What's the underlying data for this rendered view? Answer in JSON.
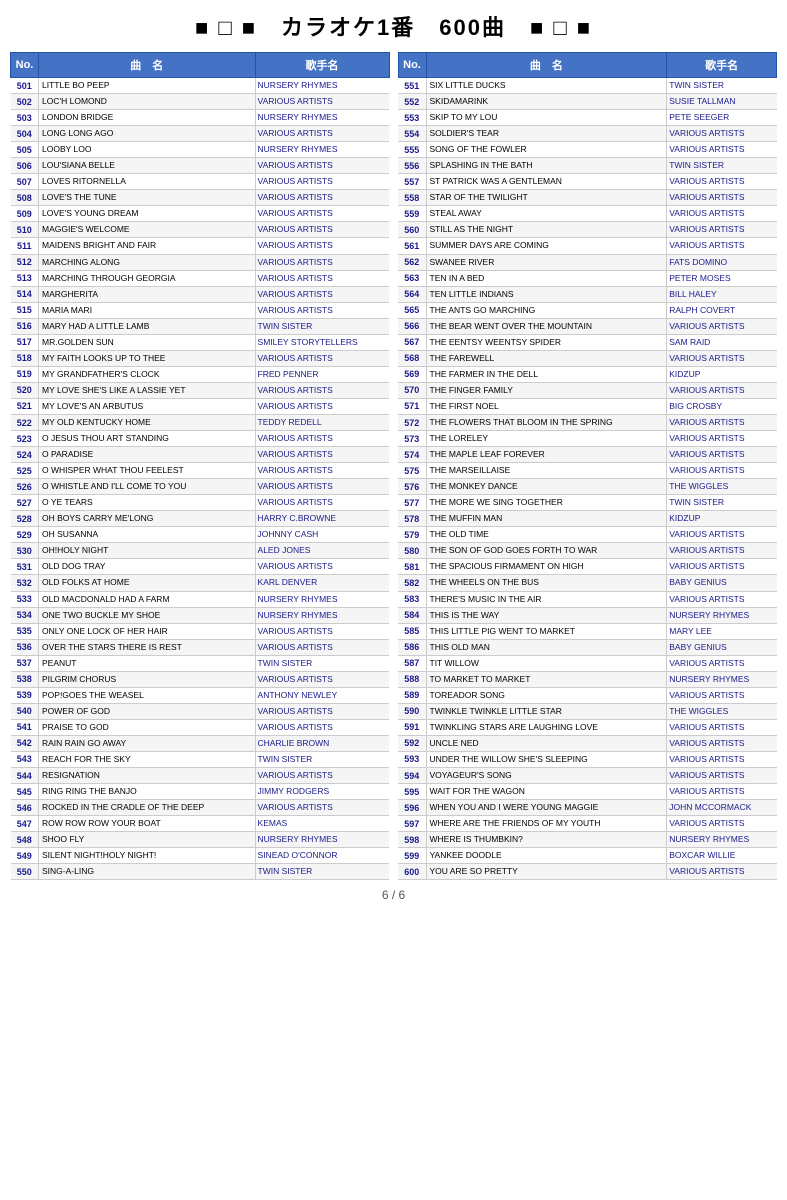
{
  "header": {
    "title": "■ □ ■　カラオケ1番　600曲　■ □ ■"
  },
  "footer": {
    "page": "6 / 6"
  },
  "left_table": {
    "headers": [
      "No.",
      "曲　名",
      "歌手名"
    ],
    "rows": [
      [
        "501",
        "LITTLE BO PEEP",
        "NURSERY RHYMES"
      ],
      [
        "502",
        "LOC'H LOMOND",
        "VARIOUS ARTISTS"
      ],
      [
        "503",
        "LONDON BRIDGE",
        "NURSERY RHYMES"
      ],
      [
        "504",
        "LONG LONG AGO",
        "VARIOUS ARTISTS"
      ],
      [
        "505",
        "LOOBY LOO",
        "NURSERY RHYMES"
      ],
      [
        "506",
        "LOU'SIANA BELLE",
        "VARIOUS ARTISTS"
      ],
      [
        "507",
        "LOVES RITORNELLA",
        "VARIOUS ARTISTS"
      ],
      [
        "508",
        "LOVE'S THE TUNE",
        "VARIOUS ARTISTS"
      ],
      [
        "509",
        "LOVE'S YOUNG DREAM",
        "VARIOUS ARTISTS"
      ],
      [
        "510",
        "MAGGIE'S WELCOME",
        "VARIOUS ARTISTS"
      ],
      [
        "511",
        "MAIDENS BRIGHT AND FAIR",
        "VARIOUS ARTISTS"
      ],
      [
        "512",
        "MARCHING ALONG",
        "VARIOUS ARTISTS"
      ],
      [
        "513",
        "MARCHING THROUGH GEORGIA",
        "VARIOUS ARTISTS"
      ],
      [
        "514",
        "MARGHERITA",
        "VARIOUS ARTISTS"
      ],
      [
        "515",
        "MARIA MARI",
        "VARIOUS ARTISTS"
      ],
      [
        "516",
        "MARY HAD A LITTLE LAMB",
        "TWIN SISTER"
      ],
      [
        "517",
        "MR.GOLDEN SUN",
        "SMILEY STORYTELLERS"
      ],
      [
        "518",
        "MY FAITH LOOKS UP TO THEE",
        "VARIOUS ARTISTS"
      ],
      [
        "519",
        "MY GRANDFATHER'S CLOCK",
        "FRED PENNER"
      ],
      [
        "520",
        "MY LOVE SHE'S LIKE A LASSIE YET",
        "VARIOUS ARTISTS"
      ],
      [
        "521",
        "MY LOVE'S AN ARBUTUS",
        "VARIOUS ARTISTS"
      ],
      [
        "522",
        "MY OLD KENTUCKY HOME",
        "TEDDY REDELL"
      ],
      [
        "523",
        "O JESUS THOU ART STANDING",
        "VARIOUS ARTISTS"
      ],
      [
        "524",
        "O PARADISE",
        "VARIOUS ARTISTS"
      ],
      [
        "525",
        "O WHISPER WHAT THOU FEELEST",
        "VARIOUS ARTISTS"
      ],
      [
        "526",
        "O WHISTLE AND I'LL COME TO YOU",
        "VARIOUS ARTISTS"
      ],
      [
        "527",
        "O YE TEARS",
        "VARIOUS ARTISTS"
      ],
      [
        "528",
        "OH BOYS CARRY ME'LONG",
        "HARRY C.BROWNE"
      ],
      [
        "529",
        "OH SUSANNA",
        "JOHNNY CASH"
      ],
      [
        "530",
        "OH!HOLY NIGHT",
        "ALED JONES"
      ],
      [
        "531",
        "OLD DOG TRAY",
        "VARIOUS ARTISTS"
      ],
      [
        "532",
        "OLD FOLKS AT HOME",
        "KARL DENVER"
      ],
      [
        "533",
        "OLD MACDONALD HAD A FARM",
        "NURSERY RHYMES"
      ],
      [
        "534",
        "ONE TWO BUCKLE MY SHOE",
        "NURSERY RHYMES"
      ],
      [
        "535",
        "ONLY ONE LOCK OF HER HAIR",
        "VARIOUS ARTISTS"
      ],
      [
        "536",
        "OVER THE STARS THERE IS REST",
        "VARIOUS ARTISTS"
      ],
      [
        "537",
        "PEANUT",
        "TWIN SISTER"
      ],
      [
        "538",
        "PILGRIM CHORUS",
        "VARIOUS ARTISTS"
      ],
      [
        "539",
        "POP!GOES THE WEASEL",
        "ANTHONY NEWLEY"
      ],
      [
        "540",
        "POWER OF GOD",
        "VARIOUS ARTISTS"
      ],
      [
        "541",
        "PRAISE TO GOD",
        "VARIOUS ARTISTS"
      ],
      [
        "542",
        "RAIN RAIN GO AWAY",
        "CHARLIE BROWN"
      ],
      [
        "543",
        "REACH FOR THE SKY",
        "TWIN SISTER"
      ],
      [
        "544",
        "RESIGNATION",
        "VARIOUS ARTISTS"
      ],
      [
        "545",
        "RING RING THE BANJO",
        "JIMMY RODGERS"
      ],
      [
        "546",
        "ROCKED IN THE CRADLE OF THE DEEP",
        "VARIOUS ARTISTS"
      ],
      [
        "547",
        "ROW ROW ROW YOUR BOAT",
        "KEMAS"
      ],
      [
        "548",
        "SHOO FLY",
        "NURSERY RHYMES"
      ],
      [
        "549",
        "SILENT NIGHT!HOLY NIGHT!",
        "SINEAD O'CONNOR"
      ],
      [
        "550",
        "SING-A-LING",
        "TWIN SISTER"
      ]
    ]
  },
  "right_table": {
    "headers": [
      "No.",
      "曲　名",
      "歌手名"
    ],
    "rows": [
      [
        "551",
        "SIX LITTLE DUCKS",
        "TWIN SISTER"
      ],
      [
        "552",
        "SKIDAMARINK",
        "SUSIE TALLMAN"
      ],
      [
        "553",
        "SKIP TO MY LOU",
        "PETE SEEGER"
      ],
      [
        "554",
        "SOLDIER'S TEAR",
        "VARIOUS ARTISTS"
      ],
      [
        "555",
        "SONG OF THE FOWLER",
        "VARIOUS ARTISTS"
      ],
      [
        "556",
        "SPLASHING IN THE BATH",
        "TWIN SISTER"
      ],
      [
        "557",
        "ST PATRICK WAS A GENTLEMAN",
        "VARIOUS ARTISTS"
      ],
      [
        "558",
        "STAR OF THE TWILIGHT",
        "VARIOUS ARTISTS"
      ],
      [
        "559",
        "STEAL AWAY",
        "VARIOUS ARTISTS"
      ],
      [
        "560",
        "STILL AS THE NIGHT",
        "VARIOUS ARTISTS"
      ],
      [
        "561",
        "SUMMER DAYS ARE COMING",
        "VARIOUS ARTISTS"
      ],
      [
        "562",
        "SWANEE RIVER",
        "FATS DOMINO"
      ],
      [
        "563",
        "TEN IN A BED",
        "PETER MOSES"
      ],
      [
        "564",
        "TEN LITTLE INDIANS",
        "BILL HALEY"
      ],
      [
        "565",
        "THE ANTS GO MARCHING",
        "RALPH COVERT"
      ],
      [
        "566",
        "THE BEAR WENT OVER THE MOUNTAIN",
        "VARIOUS ARTISTS"
      ],
      [
        "567",
        "THE EENTSY WEENTSY SPIDER",
        "SAM RAID"
      ],
      [
        "568",
        "THE FAREWELL",
        "VARIOUS ARTISTS"
      ],
      [
        "569",
        "THE FARMER IN THE DELL",
        "KIDZUP"
      ],
      [
        "570",
        "THE FINGER FAMILY",
        "VARIOUS ARTISTS"
      ],
      [
        "571",
        "THE FIRST NOEL",
        "BIG CROSBY"
      ],
      [
        "572",
        "THE FLOWERS THAT BLOOM IN THE SPRING",
        "VARIOUS ARTISTS"
      ],
      [
        "573",
        "THE LORELEY",
        "VARIOUS ARTISTS"
      ],
      [
        "574",
        "THE MAPLE LEAF FOREVER",
        "VARIOUS ARTISTS"
      ],
      [
        "575",
        "THE MARSEILLAISE",
        "VARIOUS ARTISTS"
      ],
      [
        "576",
        "THE MONKEY DANCE",
        "THE WIGGLES"
      ],
      [
        "577",
        "THE MORE WE SING TOGETHER",
        "TWIN SISTER"
      ],
      [
        "578",
        "THE MUFFIN MAN",
        "KIDZUP"
      ],
      [
        "579",
        "THE OLD TIME",
        "VARIOUS ARTISTS"
      ],
      [
        "580",
        "THE SON OF GOD GOES FORTH TO WAR",
        "VARIOUS ARTISTS"
      ],
      [
        "581",
        "THE SPACIOUS FIRMAMENT ON HIGH",
        "VARIOUS ARTISTS"
      ],
      [
        "582",
        "THE WHEELS ON THE BUS",
        "BABY GENIUS"
      ],
      [
        "583",
        "THERE'S MUSIC IN THE AIR",
        "VARIOUS ARTISTS"
      ],
      [
        "584",
        "THIS IS THE WAY",
        "NURSERY RHYMES"
      ],
      [
        "585",
        "THIS LITTLE PIG WENT TO MARKET",
        "MARY LEE"
      ],
      [
        "586",
        "THIS OLD MAN",
        "BABY GENIUS"
      ],
      [
        "587",
        "TIT WILLOW",
        "VARIOUS ARTISTS"
      ],
      [
        "588",
        "TO MARKET TO MARKET",
        "NURSERY RHYMES"
      ],
      [
        "589",
        "TOREADOR SONG",
        "VARIOUS ARTISTS"
      ],
      [
        "590",
        "TWINKLE TWINKLE LITTLE  STAR",
        "THE  WIGGLES"
      ],
      [
        "591",
        "TWINKLING STARS ARE LAUGHING LOVE",
        "VARIOUS ARTISTS"
      ],
      [
        "592",
        "UNCLE NED",
        "VARIOUS ARTISTS"
      ],
      [
        "593",
        "UNDER THE WILLOW SHE'S SLEEPING",
        "VARIOUS ARTISTS"
      ],
      [
        "594",
        "VOYAGEUR'S SONG",
        "VARIOUS ARTISTS"
      ],
      [
        "595",
        "WAIT FOR THE WAGON",
        "VARIOUS ARTISTS"
      ],
      [
        "596",
        "WHEN YOU AND I WERE YOUNG MAGGIE",
        "JOHN MCCORMACK"
      ],
      [
        "597",
        "WHERE ARE THE FRIENDS OF MY YOUTH",
        "VARIOUS ARTISTS"
      ],
      [
        "598",
        "WHERE IS THUMBKIN?",
        "NURSERY RHYMES"
      ],
      [
        "599",
        "YANKEE DOODLE",
        "BOXCAR WILLIE"
      ],
      [
        "600",
        "YOU ARE SO PRETTY",
        "VARIOUS ARTISTS"
      ]
    ]
  }
}
